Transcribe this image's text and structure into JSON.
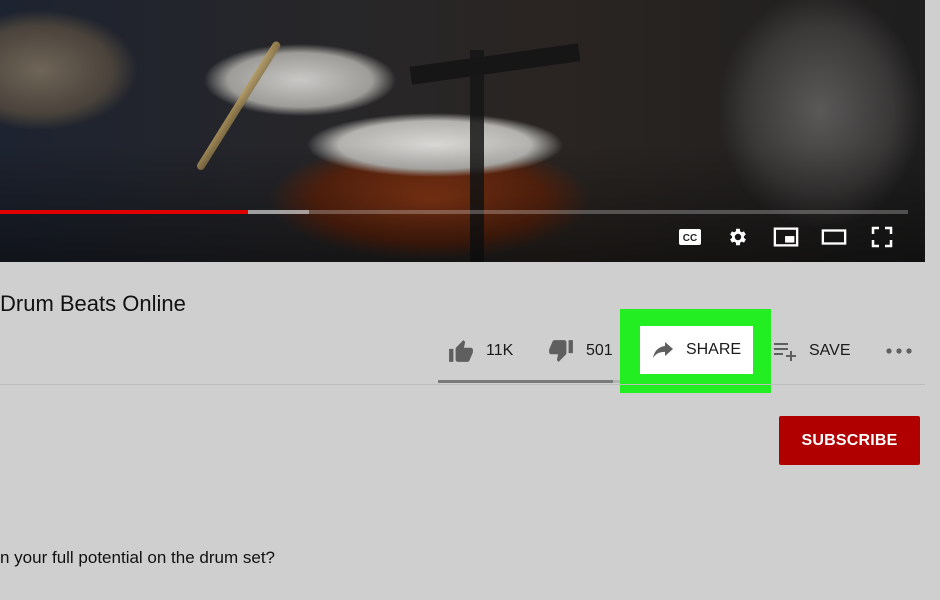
{
  "video": {
    "progress_played_fraction": 0.273,
    "progress_buffered_fraction": 0.34,
    "controls": [
      {
        "name": "cc-icon"
      },
      {
        "name": "gear-icon"
      },
      {
        "name": "miniplayer-icon"
      },
      {
        "name": "theater-mode-icon"
      },
      {
        "name": "fullscreen-icon"
      }
    ],
    "accent_color": "#e00000"
  },
  "title": "Drum Beats Online",
  "actions": {
    "like": {
      "icon": "thumbs-up-icon",
      "count": "11K"
    },
    "dislike": {
      "icon": "thumbs-down-icon",
      "count": "501"
    },
    "share": {
      "icon": "share-arrow-icon",
      "label": "SHARE",
      "highlight_color": "#22ee22"
    },
    "save": {
      "icon": "playlist-add-icon",
      "label": "SAVE"
    },
    "more": {
      "icon": "more-horizontal-icon",
      "label": "..."
    }
  },
  "sentiment": {
    "like_fraction": 0.96
  },
  "subscribe": {
    "label": "SUBSCRIBE",
    "color": "#b00000"
  },
  "description": "n your full potential on the drum set?"
}
